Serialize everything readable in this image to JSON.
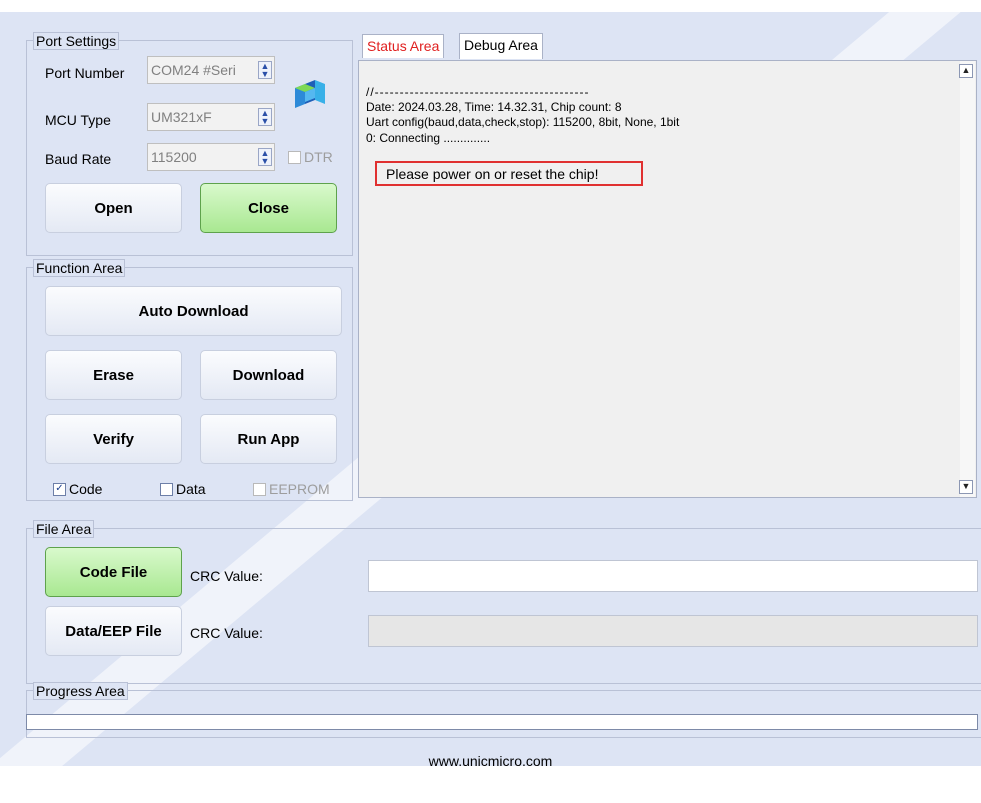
{
  "port_settings": {
    "legend": "Port Settings",
    "port_number_label": "Port Number",
    "port_number_value": "COM24 #Seri",
    "mcu_type_label": "MCU Type",
    "mcu_type_value": "UM321xF",
    "baud_rate_label": "Baud Rate",
    "baud_rate_value": "115200",
    "dtr_label": "DTR",
    "dtr_checked": false,
    "open_label": "Open",
    "close_label": "Close"
  },
  "function_area": {
    "legend": "Function Area",
    "auto_download_label": "Auto Download",
    "erase_label": "Erase",
    "download_label": "Download",
    "verify_label": "Verify",
    "run_app_label": "Run App",
    "code_label": "Code",
    "code_checked": true,
    "data_label": "Data",
    "data_checked": false,
    "eeprom_label": "EEPROM",
    "eeprom_checked": false
  },
  "tabs": {
    "status_label": "Status Area",
    "debug_label": "Debug Area",
    "active": "Status Area"
  },
  "log": {
    "lines": [
      "//-------------------------------------------",
      "Date: 2024.03.28, Time: 14.32.31, Chip count: 8",
      "Uart config(baud,data,check,stop): 115200, 8bit, None, 1bit",
      "0: Connecting ..............",
      "Please power on or reset the chip!"
    ]
  },
  "file_area": {
    "legend": "File Area",
    "code_file_label": "Code File",
    "data_eep_file_label": "Data/EEP File",
    "crc_label_1": "CRC Value:",
    "crc_label_2": "CRC Value:",
    "crc_value_1": "",
    "crc_value_2": ""
  },
  "progress_area": {
    "legend": "Progress Area",
    "progress": 0
  },
  "footer": {
    "website": "www.unicmicro.com"
  },
  "colors": {
    "background": "#dde4f4",
    "active_tab_text": "#e02020",
    "alert_border": "#e03030",
    "green_button": "#a9e891"
  }
}
